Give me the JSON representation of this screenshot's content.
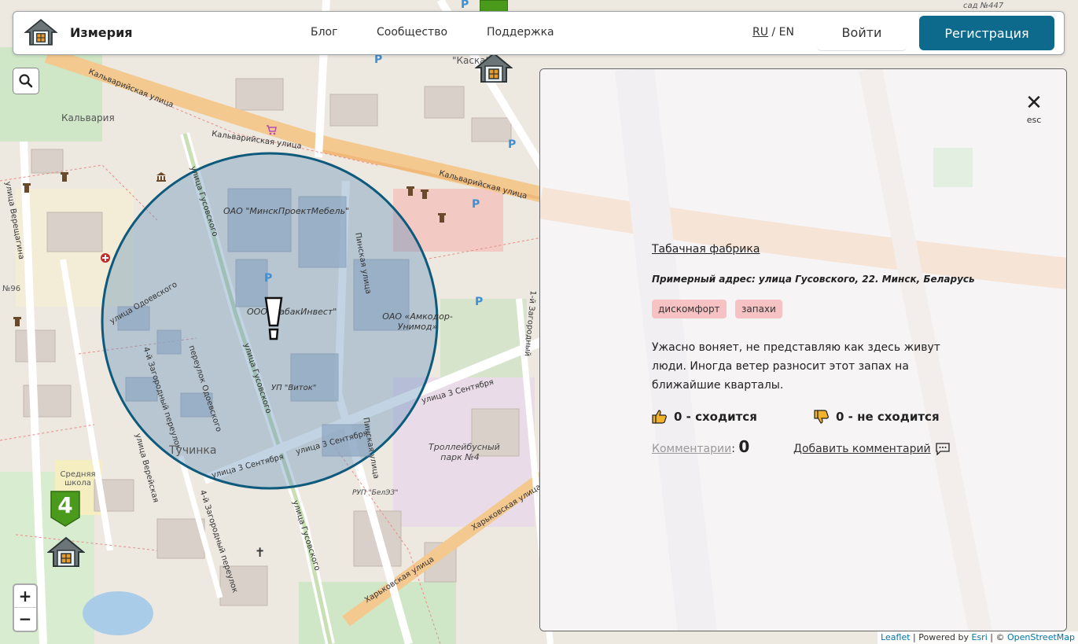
{
  "header": {
    "logo_text": "Измерия",
    "nav": [
      "Блог",
      "Сообщество",
      "Поддержка"
    ],
    "lang_ru": "RU",
    "lang_sep": " / ",
    "lang_en": "EN",
    "login_label": "Войти",
    "register_label": "Регистрация"
  },
  "map": {
    "streets": {
      "kalvariyskaya_1": "Кальварийская улица",
      "kalvariyskaya_2": "Кальварийская улица",
      "kalvariyskaya_3": "Кальварийская улица",
      "gusovskogo_1": "улица Гусовского",
      "gusovskogo_2": "улица Гусовского",
      "gusovskogo_3": "улица Гусовского",
      "odoevskogo": "улица Одоевского",
      "zagorodny4": "4-й Загородный переулок",
      "zagorodny4_2": "4-й Загородный переулок",
      "odoevskogo_per": "переулок Одоевского",
      "sentyabrya_1": "улица 3 Сентября",
      "sentyabrya_2": "улица 3 Сентября",
      "sentyabrya_3": "улица 3 Сентября",
      "pinskaya_1": "Пинская улица",
      "pinskaya_2": "Пинская улица",
      "kharkovskaya_1": "Харьковская улица",
      "kharkovskaya_2": "Харьковская улица",
      "vereyskaya": "улица Верейская",
      "vereshchagina": "улица Верещагина",
      "zagorodny1": "1-й Загородный"
    },
    "places": {
      "kalvariya": "Кальвария",
      "minskproekt": "ОАО \"МинскПроектМебель\"",
      "tabakinvest": "ООО \"ТабакИнвест\"",
      "amkodor": "ОАО «Амкодор-Унимод»",
      "vitok": "УП \"Виток\"",
      "tuchinka": "Тучинка",
      "trolley": "Троллейбусный парк №4",
      "belez": "РУП \"БелЭЗ\"",
      "school": "Средняя школа",
      "kask": "\"Каска\"",
      "sad": "сад №447",
      "n96": "№96"
    },
    "school_number": "4",
    "alert_symbol": "!",
    "parking_symbol": "P",
    "search_icon": "search-icon",
    "zoom_in": "+",
    "zoom_out": "−",
    "colors": {
      "circle_stroke": "#0e5a7c",
      "circle_fill": "#5e8fb8",
      "tag_bg": "#f6c2c4",
      "register_bg": "#0e6a8c"
    }
  },
  "attribution": {
    "leaflet": "Leaflet",
    "sep1": " | Powered by ",
    "esri": "Esri",
    "sep2": " | © ",
    "osm": "OpenStreetMap"
  },
  "panel": {
    "close_symbol": "✕",
    "close_hint": "esc",
    "title": "Табачная фабрика",
    "address": "Примерный адрес: улица Гусовского, 22. Минск, Беларусь",
    "tags": [
      "дискомфорт",
      "запахи"
    ],
    "comment": "Ужасно воняет, не представляю как здесь живут люди. Иногда ветер разносит этот запах на ближайшие кварталы.",
    "agree": "0 - сходится",
    "disagree": "0 - не сходится",
    "comments_label": "Комментарии",
    "comments_colon": ":",
    "comments_count": "0",
    "add_comment": "Добавить комментарий"
  }
}
